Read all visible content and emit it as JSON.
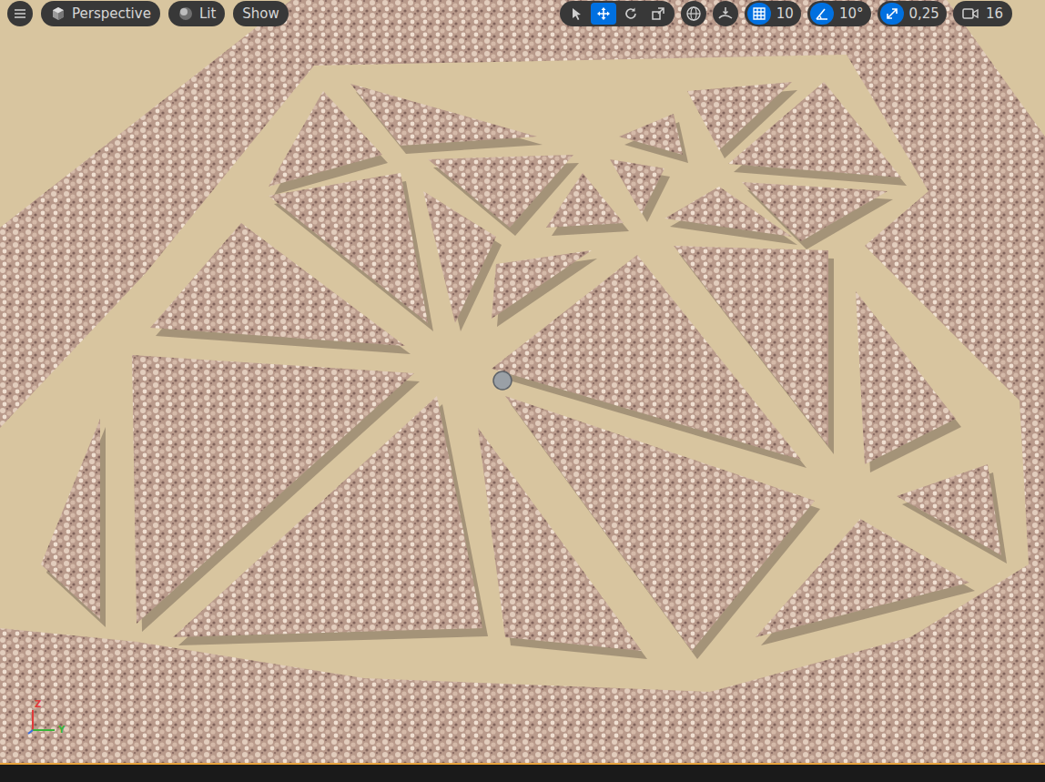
{
  "viewport": {
    "view_mode": "Perspective",
    "lighting": "Lit",
    "show": "Show"
  },
  "transform_tools": [
    {
      "kind": "select",
      "selected": false
    },
    {
      "kind": "translate",
      "selected": true
    },
    {
      "kind": "rotate",
      "selected": false
    },
    {
      "kind": "scale",
      "selected": false
    }
  ],
  "snapping": [
    {
      "kind": "grid",
      "value": "10",
      "on": true
    },
    {
      "kind": "angle",
      "value": "10°",
      "on": true
    },
    {
      "kind": "scale",
      "value": "0,25",
      "on": true
    }
  ],
  "camera_speed": "16",
  "axis_labels": [
    "Z",
    "Y"
  ]
}
